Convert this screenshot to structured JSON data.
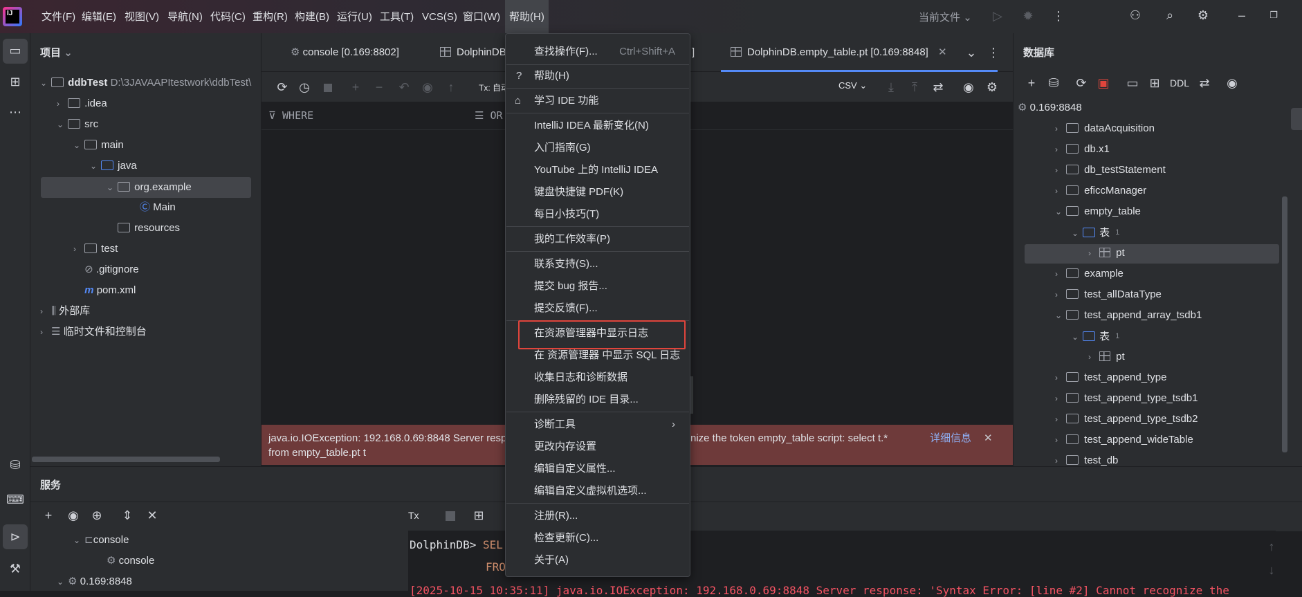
{
  "menubar": {
    "items": [
      "文件(F)",
      "编辑(E)",
      "视图(V)",
      "导航(N)",
      "代码(C)",
      "重构(R)",
      "构建(B)",
      "运行(U)",
      "工具(T)",
      "VCS(S)",
      "窗口(W)",
      "帮助(H)"
    ],
    "run_config": "当前文件"
  },
  "project": {
    "title": "项目",
    "rows": [
      {
        "label": "ddbTest",
        "extra": "D:\\3JAVAAPItestwork\\ddbTest\\"
      },
      {
        "label": ".idea"
      },
      {
        "label": "src"
      },
      {
        "label": "main"
      },
      {
        "label": "java"
      },
      {
        "label": "org.example"
      },
      {
        "label": "Main"
      },
      {
        "label": "resources"
      },
      {
        "label": "test"
      },
      {
        "label": ".gitignore"
      },
      {
        "label": "pom.xml"
      },
      {
        "label": "外部库"
      },
      {
        "label": "临时文件和控制台"
      }
    ]
  },
  "editor": {
    "tabs": [
      {
        "label": "console [0.169:8802]"
      },
      {
        "label": "DolphinDB"
      },
      {
        "label": "]"
      },
      {
        "label": "DolphinDB.empty_table.pt [0.169:8848]"
      }
    ],
    "tx_label": "Tx: 自动",
    "csv_label": "CSV",
    "where_label": "WHERE",
    "orderby_label": "OR",
    "error": {
      "text_line1": "java.io.IOException: 192.168.0.69:8848 Server respon",
      "text_line1b": "nize the token empty_table script: select t.*",
      "text_line2": "from empty_table.pt t",
      "details_link": "详细信息"
    }
  },
  "database": {
    "title": "数据库",
    "ddl_label": "DDL",
    "connection": "0.169:8848",
    "rows": [
      {
        "label": "dataAcquisition",
        "type": "schema",
        "level": 1,
        "open": false
      },
      {
        "label": "db.x1",
        "type": "schema",
        "level": 1,
        "open": false
      },
      {
        "label": "db_testStatement",
        "type": "schema",
        "level": 1,
        "open": false
      },
      {
        "label": "eficcManager",
        "type": "schema",
        "level": 1,
        "open": false
      },
      {
        "label": "empty_table",
        "type": "schema",
        "level": 1,
        "open": true
      },
      {
        "label": "表",
        "count": "1",
        "type": "folder",
        "level": 2,
        "open": true
      },
      {
        "label": "pt",
        "type": "table",
        "level": 3,
        "open": false,
        "selected": true
      },
      {
        "label": "example",
        "type": "schema",
        "level": 1,
        "open": false
      },
      {
        "label": "test_allDataType",
        "type": "schema",
        "level": 1,
        "open": false
      },
      {
        "label": "test_append_array_tsdb1",
        "type": "schema",
        "level": 1,
        "open": true
      },
      {
        "label": "表",
        "count": "1",
        "type": "folder",
        "level": 2,
        "open": true
      },
      {
        "label": "pt",
        "type": "table",
        "level": 3,
        "open": false
      },
      {
        "label": "test_append_type",
        "type": "schema",
        "level": 1,
        "open": false
      },
      {
        "label": "test_append_type_tsdb1",
        "type": "schema",
        "level": 1,
        "open": false
      },
      {
        "label": "test_append_type_tsdb2",
        "type": "schema",
        "level": 1,
        "open": false
      },
      {
        "label": "test_append_wideTable",
        "type": "schema",
        "level": 1,
        "open": false
      },
      {
        "label": "test_db",
        "type": "schema",
        "level": 1,
        "open": false
      }
    ]
  },
  "services": {
    "title": "服务",
    "tx_label": "Tx",
    "tree": [
      {
        "label": "console"
      },
      {
        "label": "console"
      },
      {
        "label": "0.169:8848"
      }
    ],
    "console_line1_prompt": "DolphinDB> ",
    "console_line1_code": "SEL",
    "console_line2_code": "FRO",
    "console_line3": "[2025-10-15 10:35:11] java.io.IOException: 192.168.0.69:8848 Server response: 'Syntax Error: [line #2] Cannot recognize the"
  },
  "help_menu": {
    "items": [
      {
        "label": "查找操作(F)...",
        "shortcut": "Ctrl+Shift+A"
      },
      {
        "label": "帮助(H)"
      },
      {
        "label": "学习 IDE 功能"
      },
      {
        "label": "IntelliJ IDEA 最新变化(N)"
      },
      {
        "label": "入门指南(G)"
      },
      {
        "label": "YouTube 上的 IntelliJ IDEA"
      },
      {
        "label": "键盘快捷键 PDF(K)"
      },
      {
        "label": "每日小技巧(T)"
      },
      {
        "label": "我的工作效率(P)"
      },
      {
        "label": "联系支持(S)..."
      },
      {
        "label": "提交 bug 报告..."
      },
      {
        "label": "提交反馈(F)..."
      },
      {
        "label": "在资源管理器中显示日志"
      },
      {
        "label": "在 资源管理器 中显示 SQL 日志"
      },
      {
        "label": "收集日志和诊断数据"
      },
      {
        "label": "删除残留的 IDE 目录..."
      },
      {
        "label": "诊断工具"
      },
      {
        "label": "更改内存设置"
      },
      {
        "label": "编辑自定义属性..."
      },
      {
        "label": "编辑自定义虚拟机选项..."
      },
      {
        "label": "注册(R)..."
      },
      {
        "label": "检查更新(C)..."
      },
      {
        "label": "关于(A)"
      }
    ]
  },
  "colors": {
    "highlight_box": "#e0453c",
    "error_bg": "#6e3a3a",
    "link": "#548af7"
  }
}
